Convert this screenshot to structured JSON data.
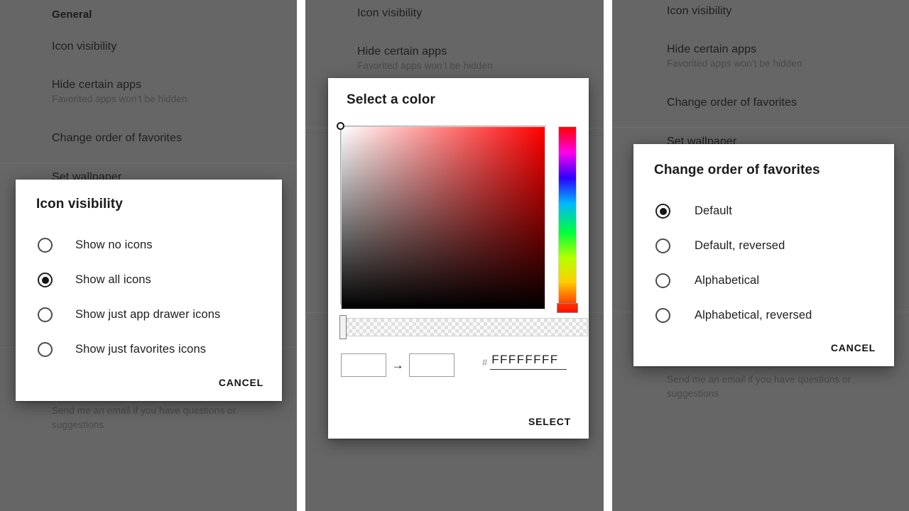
{
  "background_settings": {
    "section_header": "General",
    "items": [
      {
        "title": "Icon visibility",
        "subtitle": ""
      },
      {
        "title": "Hide certain apps",
        "subtitle": "Favorited apps won’t be hidden"
      },
      {
        "title": "Change order of favorites",
        "subtitle": ""
      },
      {
        "title": "Set wallpaper",
        "subtitle": ""
      }
    ],
    "footer_note": "Send me an email if you have questions or suggestions"
  },
  "panel_1": {
    "dialog": {
      "title": "Icon visibility",
      "options": [
        {
          "label": "Show no icons",
          "selected": false
        },
        {
          "label": "Show all icons",
          "selected": true
        },
        {
          "label": "Show just app drawer icons",
          "selected": false
        },
        {
          "label": "Show just favorites icons",
          "selected": false
        }
      ],
      "cancel_label": "CANCEL"
    }
  },
  "panel_2": {
    "dialog": {
      "title": "Select a color",
      "hex_prefix": "#",
      "hex_value": "FFFFFFFF",
      "swatch_arrow": "→",
      "current_color": "#FFFFFF",
      "new_color": "#FFFFFF",
      "select_label": "SELECT"
    }
  },
  "panel_3": {
    "dialog": {
      "title": "Change order of favorites",
      "options": [
        {
          "label": "Default",
          "selected": true
        },
        {
          "label": "Default, reversed",
          "selected": false
        },
        {
          "label": "Alphabetical",
          "selected": false
        },
        {
          "label": "Alphabetical, reversed",
          "selected": false
        }
      ],
      "cancel_label": "CANCEL"
    }
  },
  "colors": {
    "scrim": "#666666",
    "dialog_bg": "#FFFFFF",
    "text_primary": "#1E1E1E",
    "text_secondary": "#4A4A4A"
  }
}
